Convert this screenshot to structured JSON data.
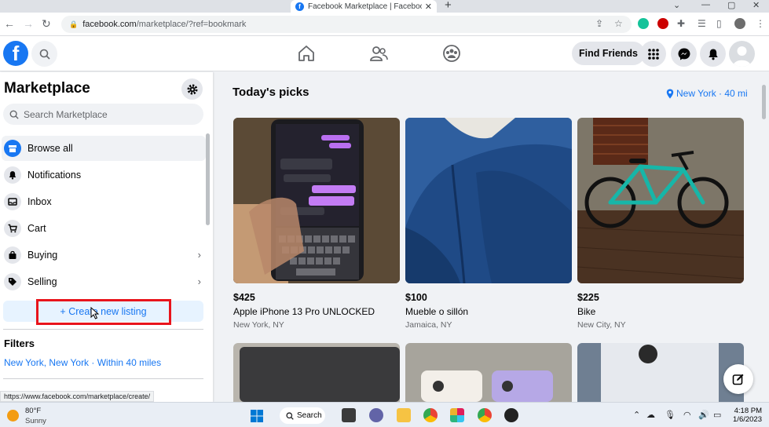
{
  "browser": {
    "tab_title": "Facebook Marketplace | Facebook",
    "url_host": "facebook.com",
    "url_path": "/marketplace/?ref=bookmark",
    "status_url": "https://www.facebook.com/marketplace/create/"
  },
  "header": {
    "find_friends": "Find Friends"
  },
  "sidebar": {
    "title": "Marketplace",
    "search_placeholder": "Search Marketplace",
    "items": [
      {
        "label": "Browse all",
        "icon": "storefront-icon"
      },
      {
        "label": "Notifications",
        "icon": "bell-icon"
      },
      {
        "label": "Inbox",
        "icon": "inbox-icon"
      },
      {
        "label": "Cart",
        "icon": "cart-icon"
      },
      {
        "label": "Buying",
        "icon": "shopping-bag-icon"
      },
      {
        "label": "Selling",
        "icon": "tag-icon"
      }
    ],
    "create_listing": "+ Create new listing",
    "filters_heading": "Filters",
    "filters_location": "New York, New York · Within 40 miles"
  },
  "main": {
    "section_title": "Today's picks",
    "location": "New York · 40 mi",
    "listings": [
      {
        "price": "$425",
        "title": "Apple iPhone 13 Pro UNLOCKED",
        "location": "New York, NY"
      },
      {
        "price": "$100",
        "title": "Mueble o sillón",
        "location": "Jamaica, NY"
      },
      {
        "price": "$225",
        "title": "Bike",
        "location": "New City, NY"
      }
    ]
  },
  "taskbar": {
    "temperature": "80°F",
    "condition": "Sunny",
    "search": "Search",
    "time": "4:18 PM",
    "date": "1/6/2023"
  },
  "colors": {
    "fb_blue": "#1877f2",
    "highlight_red": "#e8141c"
  }
}
